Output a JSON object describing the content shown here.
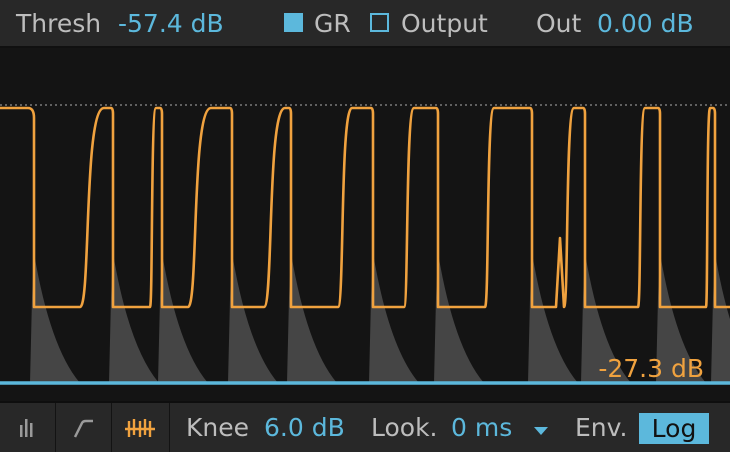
{
  "header": {
    "thresh_label": "Thresh",
    "thresh_value": "-57.4 dB",
    "gr_label": "GR",
    "gr_checked": true,
    "output_label": "Output",
    "output_checked": false,
    "out_label": "Out",
    "out_value": "0.00 dB"
  },
  "display": {
    "gr_readout": "-27.3 dB",
    "pulse_count": 10,
    "colors": {
      "background": "#141414",
      "envelope": "#f0a23f",
      "level_shading": "#4a4a4a",
      "threshold_line": "#5cb8dc",
      "dotted_reference": "#7a7a7a"
    }
  },
  "footer": {
    "meter_icon": "bar-meter-icon",
    "curve_icon": "transfer-curve-icon",
    "activity_icon": "activity-view-icon",
    "knee_label": "Knee",
    "knee_value": "6.0 dB",
    "look_label": "Look.",
    "look_value": "0 ms",
    "env_label": "Env.",
    "env_mode": "Log"
  },
  "colors": {
    "accent": "#5cb8dc",
    "orange": "#f0a23f",
    "panel": "#282828",
    "label": "#bdbdbd"
  }
}
